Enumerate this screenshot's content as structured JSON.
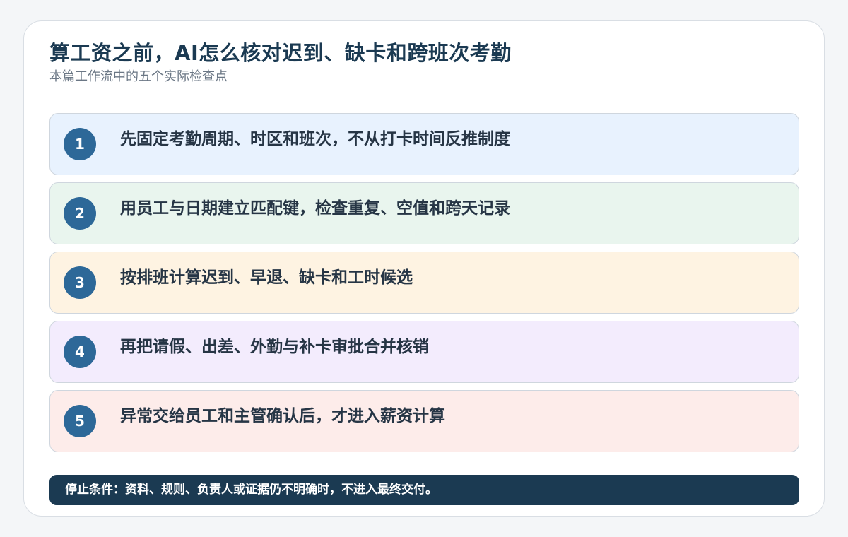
{
  "header": {
    "title": "算工资之前，AI怎么核对迟到、缺卡和跨班次考勤",
    "subtitle": "本篇工作流中的五个实际检查点"
  },
  "steps": [
    {
      "number": "1",
      "text": "先固定考勤周期、时区和班次，不从打卡时间反推制度",
      "color": "#e8f2fe"
    },
    {
      "number": "2",
      "text": "用员工与日期建立匹配键，检查重复、空值和跨天记录",
      "color": "#e9f5ee"
    },
    {
      "number": "3",
      "text": "按排班计算迟到、早退、缺卡和工时候选",
      "color": "#fef3e2"
    },
    {
      "number": "4",
      "text": "再把请假、出差、外勤与补卡审批合并核销",
      "color": "#f3ecfd"
    },
    {
      "number": "5",
      "text": "异常交给员工和主管确认后，才进入薪资计算",
      "color": "#fdecea"
    }
  ],
  "footer": {
    "stop_condition": "停止条件：资料、规则、负责人或证据仍不明确时，不进入最终交付。"
  },
  "colors": {
    "badge": "#2d6898",
    "title": "#1b3a52",
    "footer_bg": "#1b3a52"
  }
}
